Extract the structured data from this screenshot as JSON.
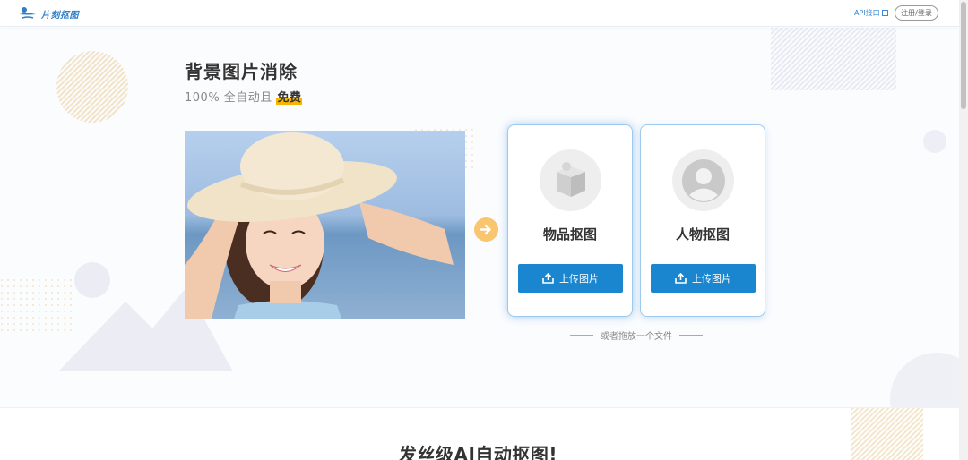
{
  "header": {
    "logo_text": "片刻抠图",
    "api_link": "API接口",
    "login_button": "注册/登录"
  },
  "hero": {
    "title": "背景图片消除",
    "subtitle_prefix": "100% 全自动且 ",
    "subtitle_highlight": "免费"
  },
  "cards": [
    {
      "title": "物品抠图",
      "button": "上传图片",
      "icon": "box-icon"
    },
    {
      "title": "人物抠图",
      "button": "上传图片",
      "icon": "user-icon"
    }
  ],
  "drop_hint": "或者拖放一个文件",
  "section_title": "发丝级AI自动抠图!",
  "colors": {
    "accent": "#1a86d0",
    "highlight": "#f7b500",
    "arrow": "#f9c56e"
  }
}
